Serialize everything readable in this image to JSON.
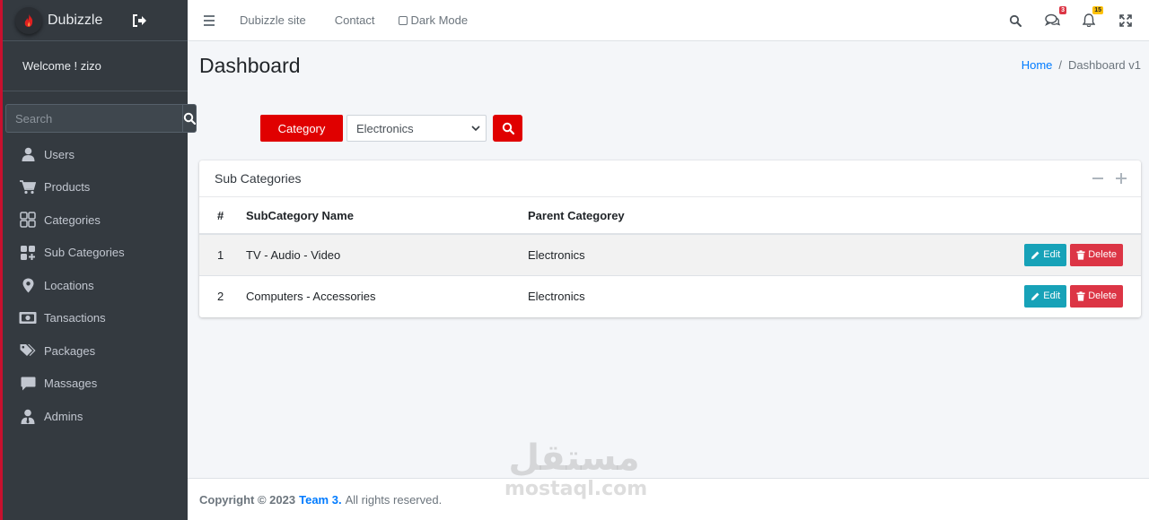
{
  "brand": {
    "name": "Dubizzle"
  },
  "sidebar": {
    "welcome": "Welcome ! zizo",
    "search_placeholder": "Search",
    "items": [
      {
        "label": "Users",
        "icon": "user-icon"
      },
      {
        "label": "Products",
        "icon": "cart-icon"
      },
      {
        "label": "Categories",
        "icon": "grid-icon"
      },
      {
        "label": "Sub Categories",
        "icon": "grid-plus-icon"
      },
      {
        "label": "Locations",
        "icon": "map-pin-icon"
      },
      {
        "label": "Tansactions",
        "icon": "money-icon"
      },
      {
        "label": "Packages",
        "icon": "tags-icon"
      },
      {
        "label": "Massages",
        "icon": "chat-icon"
      },
      {
        "label": "Admins",
        "icon": "admin-icon"
      }
    ]
  },
  "topbar": {
    "links": [
      "Dubizzle site",
      "Contact"
    ],
    "dark_mode_label": "Dark Mode",
    "messages_badge": "3",
    "notifications_badge": "15"
  },
  "page": {
    "title": "Dashboard",
    "breadcrumb": {
      "home": "Home",
      "separator": "/",
      "current": "Dashboard v1"
    }
  },
  "filter": {
    "button_label": "Category",
    "selected": "Electronics"
  },
  "card": {
    "title": "Sub Categories",
    "columns": [
      "#",
      "SubCategory Name",
      "Parent Categorey"
    ],
    "rows": [
      {
        "num": "1",
        "name": "TV - Audio - Video",
        "parent": "Electronics"
      },
      {
        "num": "2",
        "name": "Computers - Accessories",
        "parent": "Electronics"
      }
    ],
    "edit_label": "Edit",
    "delete_label": "Delete"
  },
  "footer": {
    "copyright": "Copyright © 2023",
    "team": "Team 3.",
    "rest": "All rights reserved."
  },
  "watermark": {
    "arabic": "مستقل",
    "latin": "mostaql.com"
  },
  "colors": {
    "accent": "#e00000",
    "sidebar_bg": "#343a40",
    "edit": "#17a2b8",
    "delete": "#dc3545",
    "link": "#007bff"
  }
}
